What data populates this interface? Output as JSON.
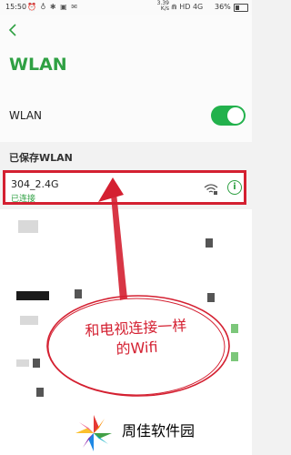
{
  "status_bar": {
    "time": "15:50",
    "left_icons": "⏰ ♁ ✱ ▣ ✉",
    "network_speed": "3.39\nK/s",
    "right_icons": "⋒ HD 4G",
    "battery": "36%"
  },
  "header": {
    "back_icon": "chevron-left-icon",
    "title": "WLAN"
  },
  "wlan_toggle": {
    "label": "WLAN",
    "enabled": true
  },
  "saved_section": {
    "title": "已保存WLAN",
    "network": {
      "ssid": "304_2.4G",
      "status": "已连接",
      "wifi_icon": "wifi-lock-icon",
      "info_icon": "info-icon"
    }
  },
  "annotation": {
    "line1": "和电视连接一样",
    "line2": "的Wifi"
  },
  "watermark": {
    "brand": "周佳软件园"
  },
  "colors": {
    "accent": "#2fa043",
    "toggle": "#22b14c",
    "annotation": "#d42031"
  }
}
